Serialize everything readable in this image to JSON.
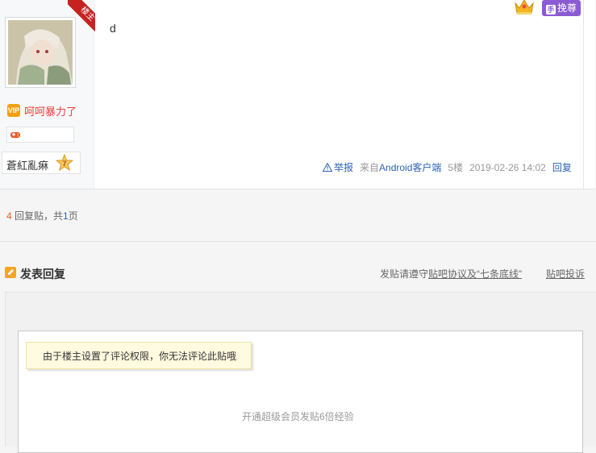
{
  "post": {
    "ribbon": "楼主",
    "username": "呵呵暴力了",
    "vip_icon_text": "VIP",
    "level_name": "蒼紅亂痳",
    "level_number": "7",
    "content": "d",
    "huanzun_label": "挽尊",
    "huanzun_icon": "手",
    "tail": {
      "report": "举报",
      "source_prefix": "来自",
      "source_link": "Android客户端",
      "floor": "5楼",
      "time": "2019-02-26 14:02",
      "reply": "回复"
    }
  },
  "pager": {
    "count": "4",
    "mid": "回复贴，共",
    "pages": "1",
    "suffix": "页"
  },
  "reply_section": {
    "title": "发表回复",
    "rule_prefix": "发贴请遵守",
    "rule_link": "贴吧协议及“七条底线”",
    "complain": "贴吧投诉",
    "permission_tip": "由于楼主设置了评论权限，你无法评论此贴哦",
    "vip_promo": "开通超级会员发贴6倍经验"
  },
  "colors": {
    "accent_red": "#e7413b",
    "link_blue": "#2d64b3",
    "ribbon_red": "#c62222",
    "huanzun_purple": "#8a5bd4",
    "reply_icon_orange": "#f6a623"
  }
}
